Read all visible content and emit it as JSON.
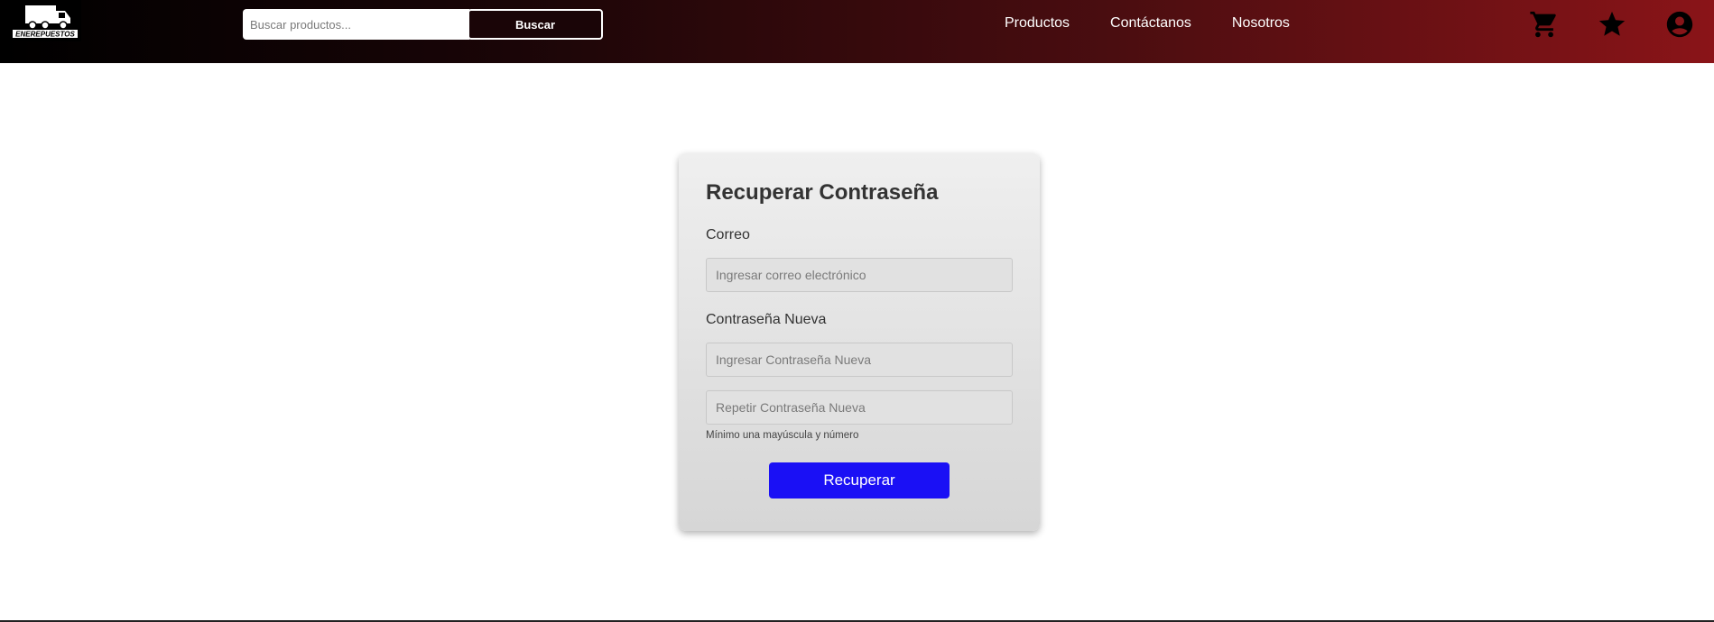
{
  "header": {
    "logo_text": "ENEREPUESTOS",
    "search": {
      "placeholder": "Buscar productos...",
      "value": "",
      "button_label": "Buscar"
    },
    "nav": [
      {
        "label": "Productos"
      },
      {
        "label": "Contáctanos"
      },
      {
        "label": "Nosotros"
      }
    ],
    "icons": [
      "cart-icon",
      "star-icon",
      "account-icon"
    ]
  },
  "form": {
    "title": "Recuperar Contraseña",
    "email_label": "Correo",
    "email_placeholder": "Ingresar correo electrónico",
    "password_label": "Contraseña Nueva",
    "password_placeholder": "Ingresar Contraseña Nueva",
    "repeat_placeholder": "Repetir Contraseña Nueva",
    "hint": "Mínimo una mayúscula y número",
    "submit_label": "Recuperar"
  },
  "colors": {
    "accent": "#1a10f5",
    "nav_gradient_end": "#8a1418"
  }
}
